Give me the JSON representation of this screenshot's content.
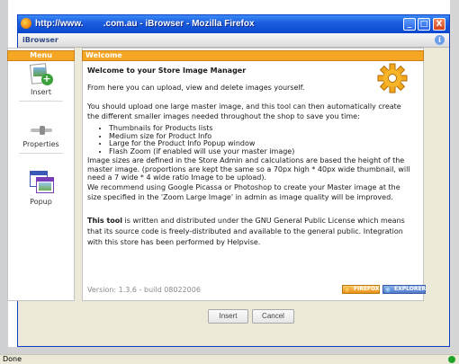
{
  "window": {
    "title": "http://www.        .com.au - iBrowser - Mozilla Firefox",
    "min_glyph": "_",
    "max_glyph": "□",
    "close_glyph": "X"
  },
  "app": {
    "name": "iBrowser",
    "info_glyph": "i"
  },
  "menu": {
    "title": "Menu",
    "items": [
      {
        "label": "Insert",
        "icon": "insert-image-icon"
      },
      {
        "label": "Properties",
        "icon": "properties-slider-icon"
      },
      {
        "label": "Popup",
        "icon": "popup-window-icon"
      }
    ]
  },
  "content": {
    "tab_title": "Welcome",
    "heading": "Welcome to your Store Image Manager",
    "intro": "From here you can upload, view and delete images yourself.",
    "para1": "You should upload one large master image, and this tool can then automatically create the different smaller images needed throughout the shop to save you time:",
    "bullets": [
      "Thumbnails for Products lists",
      "Medium size for Product Info",
      "Large for the Product Info Popup window",
      "Flash Zoom (if enabled will use your master image)"
    ],
    "para2": "Image sizes are defined in the Store Admin and calculations are based the height of the master image. (proportions are kept the same so a 70px high * 40px wide thumbnail, will need a 7 wide * 4 wide ratio Image to be upload).",
    "para3": "We recommend using Google Picassa or Photoshop to create your Master image at the size specified in the 'Zoom Large Image' in admin as image quality will be improved.",
    "tool_bold": "This tool",
    "tool_rest": " is written and distributed under the GNU General Public License which means that its source code is freely-distributed and available to the general public. Integration with this store has been performed by Helpvise.",
    "version": "Version: 1.3.6 - build 08022006",
    "badge_firefox": "FIREFOX",
    "badge_explorer": "EXPLORER"
  },
  "buttons": {
    "insert": "Insert",
    "cancel": "Cancel"
  },
  "status": {
    "text": "Done"
  },
  "colors": {
    "titlebar": "#1d5fe0",
    "panel_header": "#f5a623",
    "window_bg": "#ece9d8"
  }
}
